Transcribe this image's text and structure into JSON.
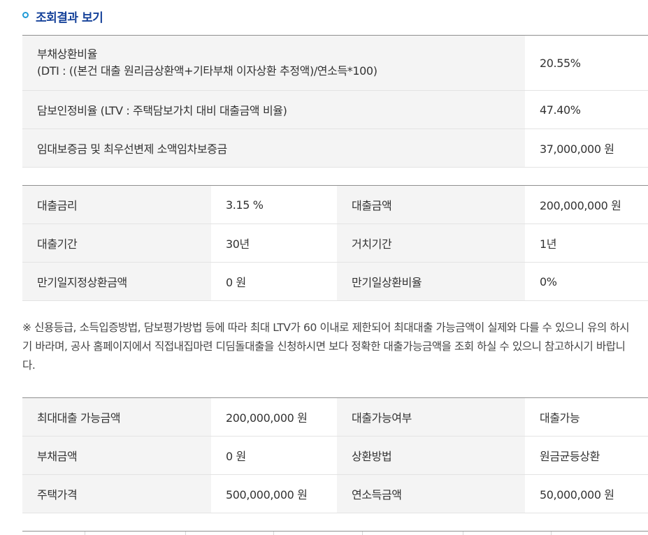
{
  "section": {
    "title": "조회결과 보기"
  },
  "ratio_table": {
    "rows": [
      {
        "label": "부채상환비율",
        "sublabel": "(DTI : ((본건 대출 원리금상환액+기타부채 이자상환 추정액)/연소득*100)",
        "value": "20.55%"
      },
      {
        "label": "담보인정비율 (LTV : 주택담보가치 대비 대출금액 비율)",
        "value": "47.40%"
      },
      {
        "label": "임대보증금 및 최우선변제 소액임차보증금",
        "value": "37,000,000 원"
      }
    ]
  },
  "loan_table": {
    "rows": [
      {
        "label1": "대출금리",
        "value1": "3.15 %",
        "label2": "대출금액",
        "value2": "200,000,000 원"
      },
      {
        "label1": "대출기간",
        "value1": "30년",
        "label2": "거치기간",
        "value2": "1년"
      },
      {
        "label1": "만기일지정상환금액",
        "value1": "0 원",
        "label2": "만기일상환비율",
        "value2": "0%"
      }
    ]
  },
  "notice": "※ 신용등급, 소득입증방법, 담보평가방법 등에 따라 최대 LTV가 60 이내로 제한되어 최대대출 가능금액이 실제와 다를 수 있으니 유의 하시기 바라며, 공사 홈페이지에서 직접내집마련 디딤돌대출을 신청하시면 보다 정확한 대출가능금액을 조회 하실 수 있으니 참고하시기 바랍니다.",
  "result_table": {
    "rows": [
      {
        "label1": "최대대출 가능금액",
        "value1": "200,000,000 원",
        "label2": "대출가능여부",
        "value2": "대출가능"
      },
      {
        "label1": "부채금액",
        "value1": "0 원",
        "label2": "상환방법",
        "value2": "원금균등상환"
      },
      {
        "label1": "주택가격",
        "value1": "500,000,000 원",
        "label2": "연소득금액",
        "value2": "50,000,000 원"
      }
    ]
  }
}
